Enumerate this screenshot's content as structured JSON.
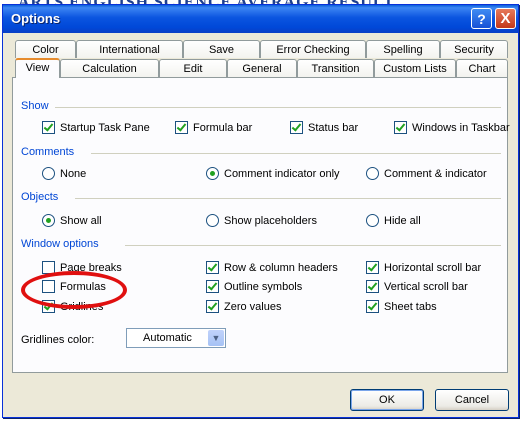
{
  "background_text": "ARTS ENGLISH SCIENCE AVERAGE RESULT",
  "window": {
    "title": "Options",
    "help_label": "?",
    "close_label": "X"
  },
  "tabs_row1": [
    "Color",
    "International",
    "Save",
    "Error Checking",
    "Spelling",
    "Security"
  ],
  "tabs_row2": [
    "View",
    "Calculation",
    "Edit",
    "General",
    "Transition",
    "Custom Lists",
    "Chart"
  ],
  "active_tab": "View",
  "sections": {
    "show": {
      "label": "Show",
      "items": [
        {
          "label": "Startup Task Pane",
          "checked": true
        },
        {
          "label": "Formula bar",
          "checked": true
        },
        {
          "label": "Status bar",
          "checked": true
        },
        {
          "label": "Windows in Taskbar",
          "checked": true
        }
      ]
    },
    "comments": {
      "label": "Comments",
      "options": [
        "None",
        "Comment indicator only",
        "Comment & indicator"
      ],
      "selected": "Comment indicator only"
    },
    "objects": {
      "label": "Objects",
      "options": [
        "Show all",
        "Show placeholders",
        "Hide all"
      ],
      "selected": "Show all"
    },
    "window_options": {
      "label": "Window options",
      "col1": [
        {
          "label": "Page breaks",
          "checked": false
        },
        {
          "label": "Formulas",
          "checked": false
        },
        {
          "label": "Gridlines",
          "checked": true
        }
      ],
      "col2": [
        {
          "label": "Row & column headers",
          "checked": true
        },
        {
          "label": "Outline symbols",
          "checked": true
        },
        {
          "label": "Zero values",
          "checked": true
        }
      ],
      "col3": [
        {
          "label": "Horizontal scroll bar",
          "checked": true
        },
        {
          "label": "Vertical scroll bar",
          "checked": true
        },
        {
          "label": "Sheet tabs",
          "checked": true
        }
      ],
      "gridlines_color_label": "Gridlines color:",
      "gridlines_color_value": "Automatic"
    }
  },
  "buttons": {
    "ok": "OK",
    "cancel": "Cancel"
  },
  "colors": {
    "titlebar": "#0054e3",
    "section_heading": "#0046d5",
    "check": "#21a121",
    "annotation": "#e01010",
    "active_tab_accent": "#e68b2c"
  }
}
